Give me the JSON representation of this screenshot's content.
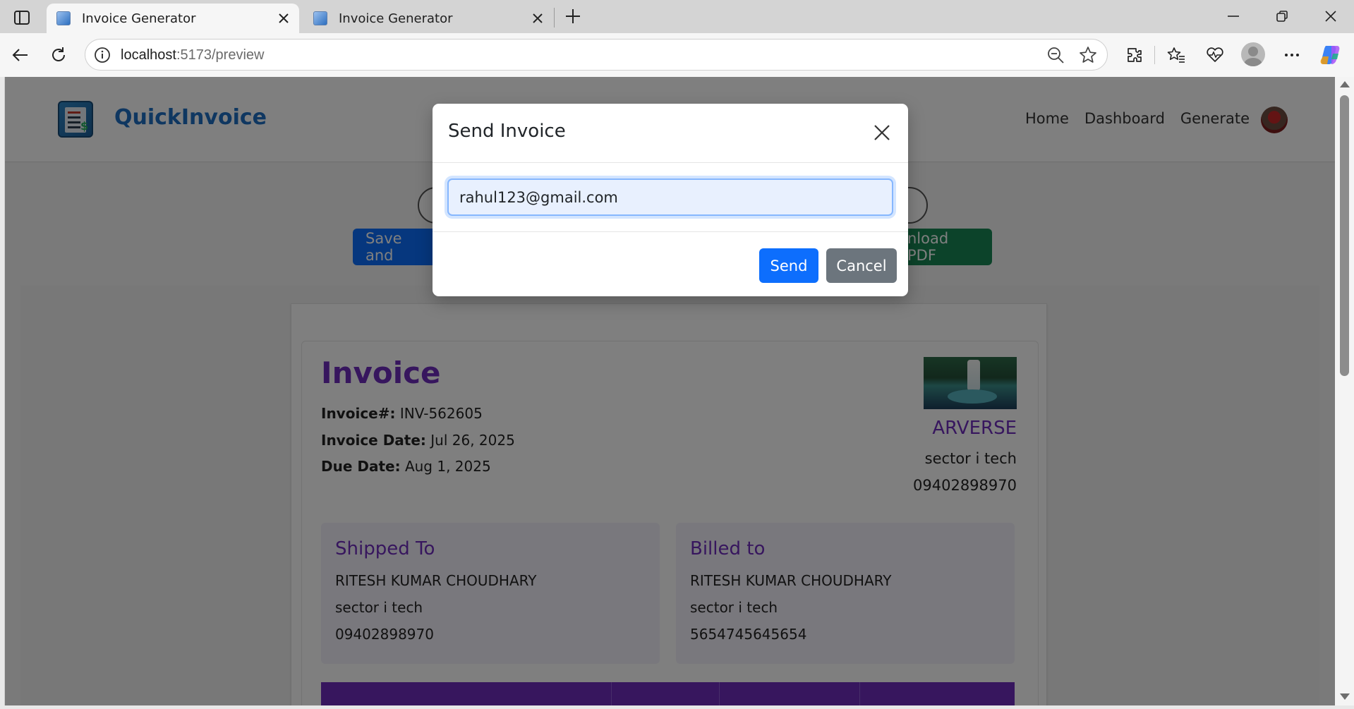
{
  "browser": {
    "tabs": [
      {
        "title": "Invoice Generator",
        "active": true
      },
      {
        "title": "Invoice Generator",
        "active": false
      }
    ],
    "url_host": "localhost",
    "url_path": ":5173/preview"
  },
  "app": {
    "brand": "QuickInvoice",
    "nav": [
      "Home",
      "Dashboard",
      "Generate"
    ],
    "actions": {
      "save": "Save and",
      "pdf": "nload PDF"
    }
  },
  "invoice": {
    "title": "Invoice",
    "number_label": "Invoice#:",
    "number": " INV-562605",
    "date_label": "Invoice Date:",
    "date": " Jul 26, 2025",
    "due_label": "Due Date:",
    "due": " Aug 1, 2025",
    "company": {
      "name": "ARVERSE",
      "address": "sector i tech",
      "phone": "09402898970"
    },
    "shipped_to": {
      "title": "Shipped To",
      "name": "RITESH KUMAR CHOUDHARY",
      "address": "sector i tech",
      "phone": "09402898970"
    },
    "billed_to": {
      "title": "Billed to",
      "name": "RITESH KUMAR CHOUDHARY",
      "address": "sector i tech",
      "phone": "5654745645654"
    }
  },
  "modal": {
    "title": "Send Invoice",
    "email_value": "rahul123@gmail.com",
    "send_label": "Send",
    "cancel_label": "Cancel"
  },
  "colors": {
    "primary": "#0d6efd",
    "secondary": "#6c757d",
    "accent_purple": "#6f2dbd",
    "brand_blue": "#1f6fc2",
    "success": "#198754"
  },
  "icons": [
    "sidebar-toggle-icon",
    "favicon-icon",
    "close-icon",
    "plus-icon",
    "minimize-icon",
    "restore-icon",
    "back-icon",
    "refresh-icon",
    "info-icon",
    "zoom-out-icon",
    "star-icon",
    "extensions-icon",
    "favorites-icon",
    "health-icon",
    "more-icon",
    "copilot-icon"
  ]
}
